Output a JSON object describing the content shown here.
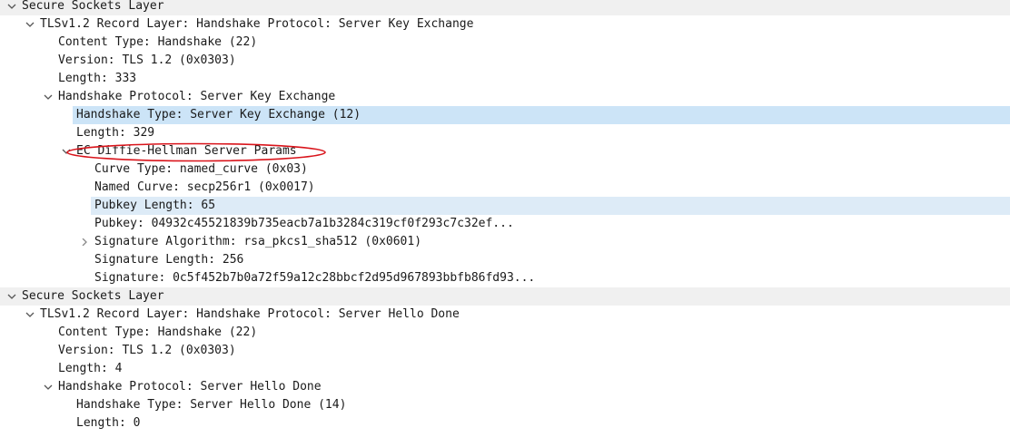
{
  "rows": [
    {
      "text": "Secure Sockets Layer",
      "level": 0,
      "toggle": "expanded",
      "shaded": true
    },
    {
      "text": "TLSv1.2 Record Layer: Handshake Protocol: Server Key Exchange",
      "level": 1,
      "toggle": "expanded"
    },
    {
      "text": "Content Type: Handshake (22)",
      "level": 2,
      "toggle": "none"
    },
    {
      "text": "Version: TLS 1.2 (0x0303)",
      "level": 2,
      "toggle": "none"
    },
    {
      "text": "Length: 333",
      "level": 2,
      "toggle": "none"
    },
    {
      "text": "Handshake Protocol: Server Key Exchange",
      "level": 2,
      "toggle": "expanded"
    },
    {
      "text": "Handshake Type: Server Key Exchange (12)",
      "level": 3,
      "toggle": "none",
      "selected": true
    },
    {
      "text": "Length: 329",
      "level": 3,
      "toggle": "none"
    },
    {
      "text": "EC Diffie-Hellman Server Params",
      "level": 3,
      "toggle": "expanded",
      "annotated": true
    },
    {
      "text": "Curve Type: named_curve (0x03)",
      "level": 4,
      "toggle": "none"
    },
    {
      "text": "Named Curve: secp256r1 (0x0017)",
      "level": 4,
      "toggle": "none"
    },
    {
      "text": "Pubkey Length: 65",
      "level": 4,
      "toggle": "none",
      "hover": true
    },
    {
      "text": "Pubkey: 04932c45521839b735eacb7a1b3284c319cf0f293c7c32ef...",
      "level": 4,
      "toggle": "none"
    },
    {
      "text": "Signature Algorithm: rsa_pkcs1_sha512 (0x0601)",
      "level": 4,
      "toggle": "collapsed"
    },
    {
      "text": "Signature Length: 256",
      "level": 4,
      "toggle": "none"
    },
    {
      "text": "Signature: 0c5f452b7b0a72f59a12c28bbcf2d95d967893bbfb86fd93...",
      "level": 4,
      "toggle": "none"
    },
    {
      "text": "Secure Sockets Layer",
      "level": 0,
      "toggle": "expanded",
      "shaded": true
    },
    {
      "text": "TLSv1.2 Record Layer: Handshake Protocol: Server Hello Done",
      "level": 1,
      "toggle": "expanded"
    },
    {
      "text": "Content Type: Handshake (22)",
      "level": 2,
      "toggle": "none"
    },
    {
      "text": "Version: TLS 1.2 (0x0303)",
      "level": 2,
      "toggle": "none"
    },
    {
      "text": "Length: 4",
      "level": 2,
      "toggle": "none"
    },
    {
      "text": "Handshake Protocol: Server Hello Done",
      "level": 2,
      "toggle": "expanded"
    },
    {
      "text": "Handshake Type: Server Hello Done (14)",
      "level": 3,
      "toggle": "none"
    },
    {
      "text": "Length: 0",
      "level": 3,
      "toggle": "none"
    }
  ],
  "annotation_color": "#d9141b",
  "selection_color": "#cce4f7"
}
